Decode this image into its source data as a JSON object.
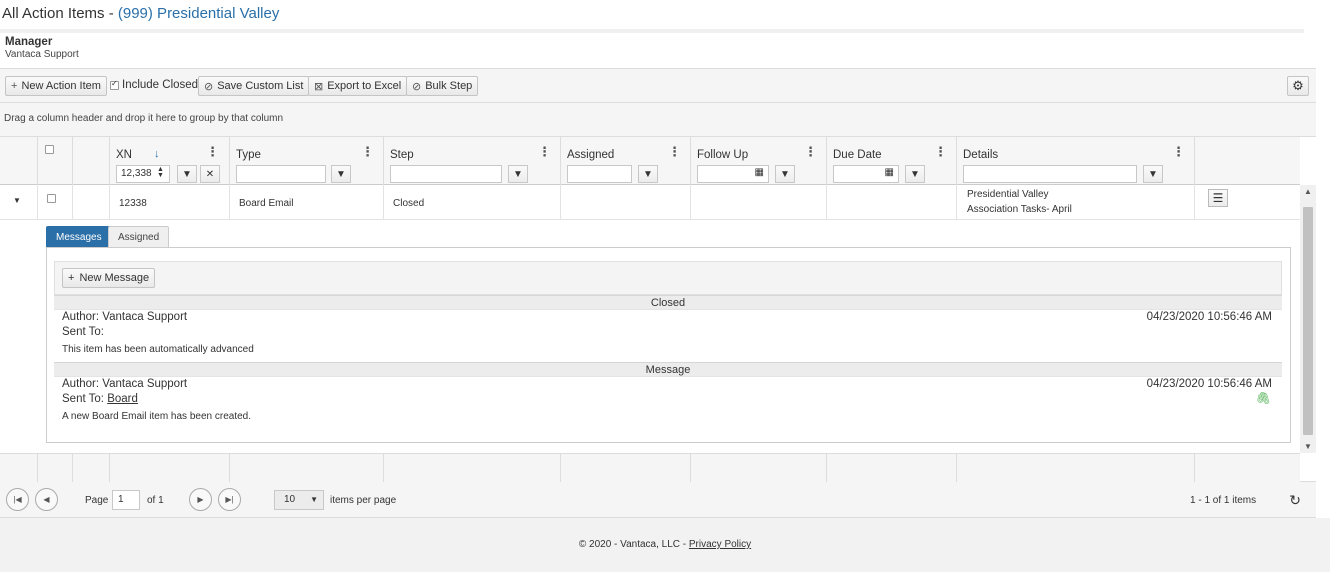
{
  "page": {
    "title_prefix": "All Action Items - ",
    "title_assoc": "(999) Presidential Valley"
  },
  "manager": {
    "label": "Manager",
    "value": "Vantaca Support"
  },
  "toolbar": {
    "new_action_item": "New Action Item",
    "include_closed": "Include Closed",
    "save_custom_list": "Save Custom List",
    "export_excel": "Export to Excel",
    "bulk_step": "Bulk Step"
  },
  "group_hint": "Drag a column header and drop it here to group by that column",
  "columns": {
    "xn": "XN",
    "type": "Type",
    "step": "Step",
    "assigned": "Assigned",
    "follow_up": "Follow Up",
    "due_date": "Due Date",
    "details": "Details"
  },
  "filters": {
    "xn_value": "12,338"
  },
  "row": {
    "xn": "12338",
    "type": "Board Email",
    "step": "Closed",
    "assigned": "",
    "follow_up": "",
    "due_date": "",
    "details_line1": "Presidential Valley",
    "details_line2": "Association Tasks- April"
  },
  "detail": {
    "tabs": [
      "Messages",
      "Assigned"
    ],
    "new_message": "New Message",
    "messages": [
      {
        "band": "Closed",
        "author": "Author: Vantaca Support",
        "sent_to_label": "Sent To:",
        "sent_to": "",
        "date": "04/23/2020 10:56:46 AM",
        "body": "This item has been automatically advanced"
      },
      {
        "band": "Message",
        "author": "Author: Vantaca Support",
        "sent_to_label": "Sent To:",
        "sent_to": "Board",
        "date": "04/23/2020 10:56:46 AM",
        "body": "A new Board Email item has been created."
      }
    ]
  },
  "pager": {
    "page_label": "Page",
    "page_value": "1",
    "of_label": "of 1",
    "page_size": "10",
    "items_per_page": "items per page",
    "summary": "1 - 1 of 1 items"
  },
  "footer": {
    "copyright": "© 2020 - Vantaca, LLC - ",
    "privacy": "Privacy Policy"
  },
  "colors": {
    "accent": "#2a6fa8",
    "attachment": "#4caf50"
  }
}
